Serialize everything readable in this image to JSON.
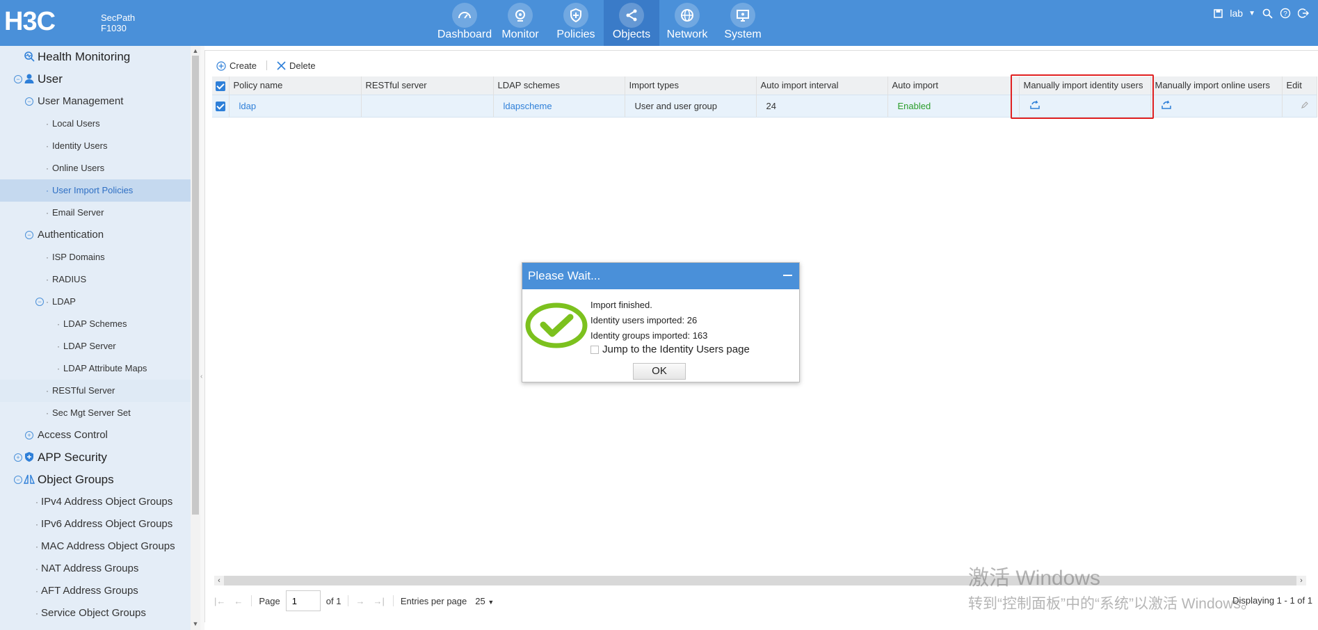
{
  "brand": {
    "logo": "H3C",
    "product_line1": "SecPath",
    "product_line2": "F1030"
  },
  "nav": [
    {
      "label": "Dashboard",
      "icon": "dashboard-icon"
    },
    {
      "label": "Monitor",
      "icon": "monitor-icon"
    },
    {
      "label": "Policies",
      "icon": "shield-icon"
    },
    {
      "label": "Objects",
      "icon": "objects-icon"
    },
    {
      "label": "Network",
      "icon": "globe-icon"
    },
    {
      "label": "System",
      "icon": "system-icon"
    }
  ],
  "top_right": {
    "user": "lab"
  },
  "sidebar": {
    "items": [
      "Health Monitoring",
      "User",
      "User Management",
      "Local Users",
      "Identity Users",
      "Online Users",
      "User Import Policies",
      "Email Server",
      "Authentication",
      "ISP Domains",
      "RADIUS",
      "LDAP",
      "LDAP Schemes",
      "LDAP Server",
      "LDAP Attribute Maps",
      "RESTful Server",
      "Sec Mgt Server Set",
      "Access Control",
      "APP Security",
      "Object Groups",
      "IPv4 Address Object Groups",
      "IPv6 Address Object Groups",
      "MAC Address Object Groups",
      "NAT Address Groups",
      "AFT Address Groups",
      "Service Object Groups"
    ]
  },
  "toolbar": {
    "create": "Create",
    "delete": "Delete"
  },
  "table": {
    "headers": [
      "Policy name",
      "RESTful server",
      "LDAP schemes",
      "Import types",
      "Auto import interval",
      "Auto import",
      "Manually import identity users",
      "Manually import online users",
      "Edit"
    ],
    "row": {
      "policy_name": "ldap",
      "restful_server": "",
      "ldap_scheme": "ldapscheme",
      "import_types": "User and user group",
      "interval": "24",
      "auto_import": "Enabled"
    }
  },
  "pager": {
    "page_label": "Page",
    "page_value": "1",
    "of": "of 1",
    "entries_label": "Entries per page",
    "entries_value": "25",
    "displaying": "Displaying 1 - 1 of 1"
  },
  "watermark": {
    "line1": "激活 Windows",
    "line2": "转到“控制面板”中的“系统”以激活 Windows。"
  },
  "dialog": {
    "title": "Please Wait...",
    "line1": "Import finished.",
    "line2": "Identity users imported: 26",
    "line3": "Identity groups imported: 163",
    "checkbox_label": "Jump to the Identity Users page",
    "ok": "OK"
  },
  "colors": {
    "accent": "#4a90d9",
    "success": "#7cc11e",
    "highlight_box": "#e02020"
  }
}
